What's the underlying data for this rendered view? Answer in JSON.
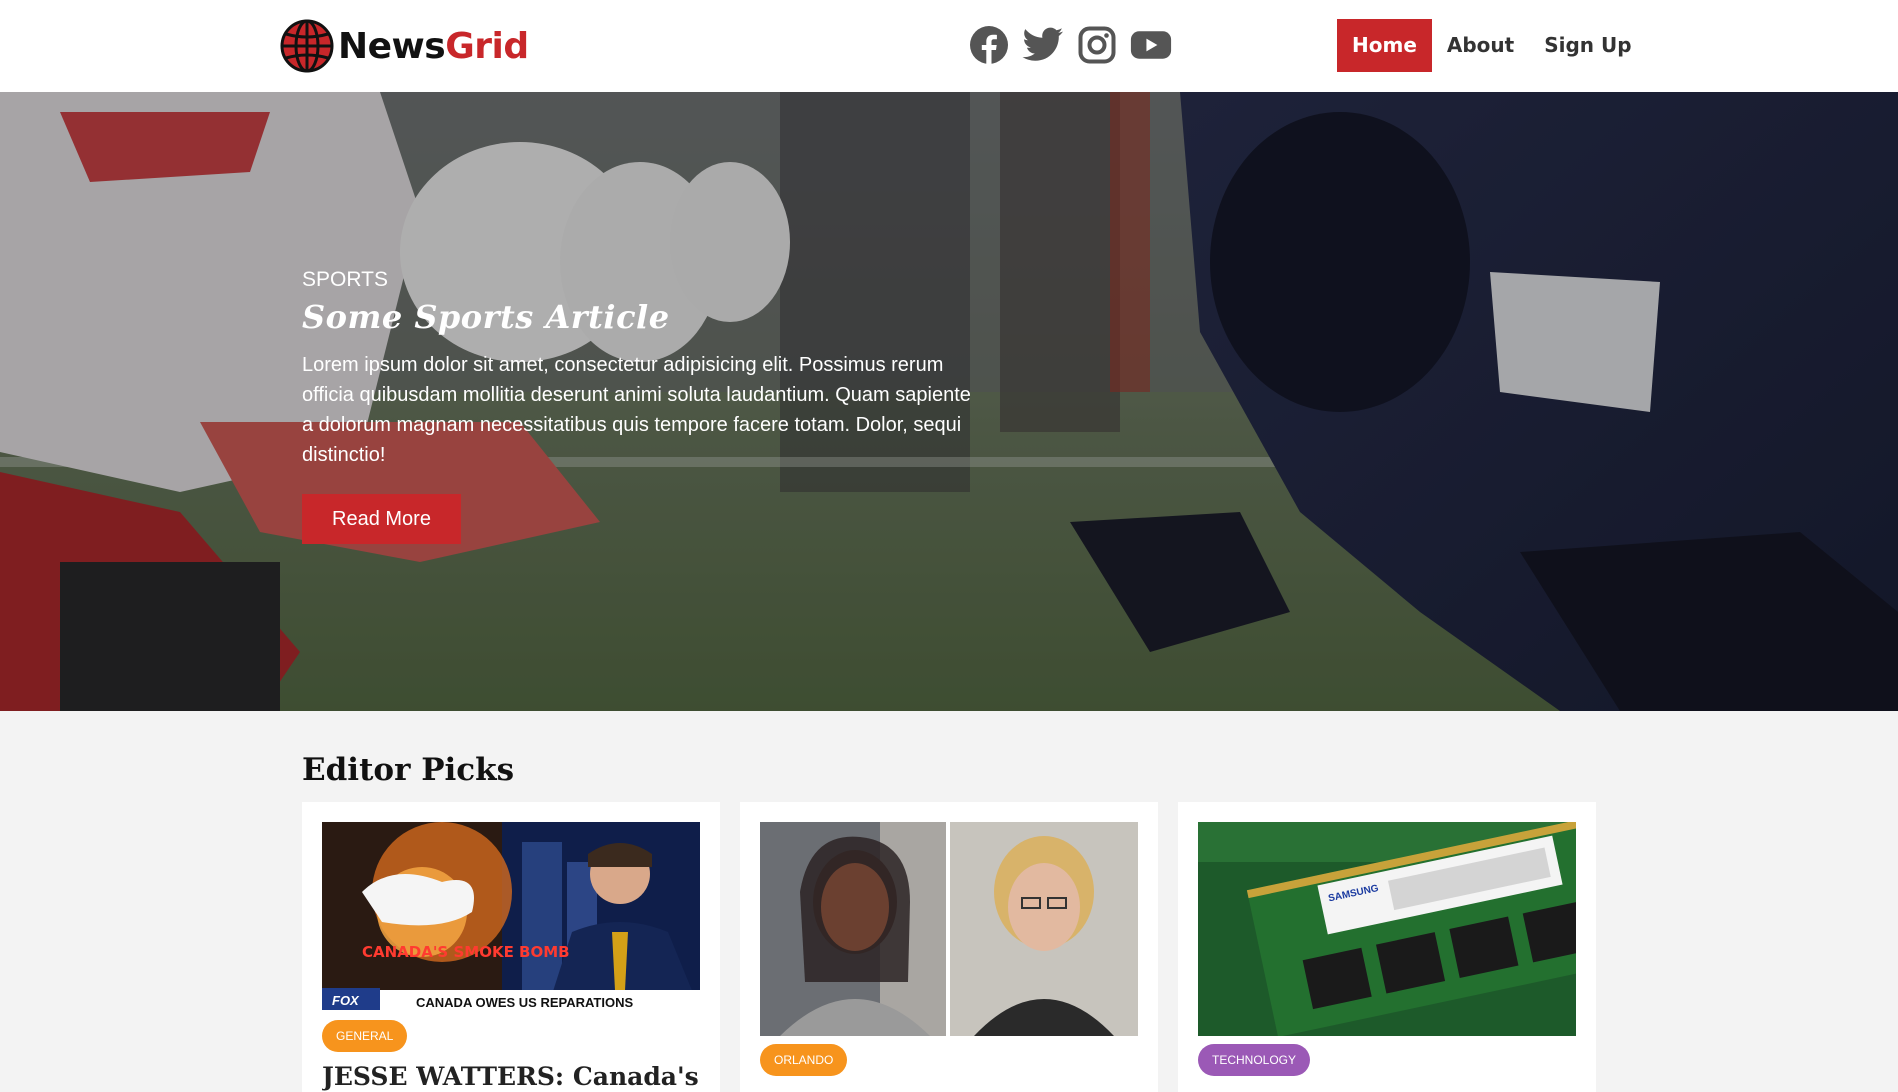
{
  "header": {
    "logo": {
      "part1": "News",
      "part2": "Grid"
    },
    "socials": [
      {
        "name": "facebook-icon"
      },
      {
        "name": "twitter-icon"
      },
      {
        "name": "instagram-icon"
      },
      {
        "name": "youtube-icon"
      }
    ],
    "nav": [
      {
        "label": "Home",
        "active": true
      },
      {
        "label": "About",
        "active": false
      },
      {
        "label": "Sign Up",
        "active": false
      }
    ]
  },
  "hero": {
    "category": "SPORTS",
    "title": "Some Sports Article",
    "text": "Lorem ipsum dolor sit amet, consectetur adipisicing elit. Possimus rerum officia quibusdam mollitia deserunt animi soluta laudantium. Quam sapiente a dolorum magnam necessitatibus quis tempore facere totam. Dolor, sequi distinctio!",
    "button": "Read More"
  },
  "editor_picks": {
    "title": "Editor Picks",
    "cards": [
      {
        "badge": "GENERAL",
        "badge_color": "#f7941d",
        "image_caption": "CANADA OWES US REPARATIONS",
        "image_headline": "CANADA'S SMOKE BOMB",
        "image_logo": "FOX",
        "title": "JESSE WATTERS: Canada's"
      },
      {
        "badge": "ORLANDO",
        "badge_color": "#f7941d",
        "title": ""
      },
      {
        "badge": "TECHNOLOGY",
        "badge_color": "#9b59b6",
        "image_label": "SAMSUNG",
        "title": ""
      }
    ]
  },
  "colors": {
    "accent": "#c8272a",
    "orange_badge": "#f7941d",
    "purple_badge": "#9b59b6"
  }
}
